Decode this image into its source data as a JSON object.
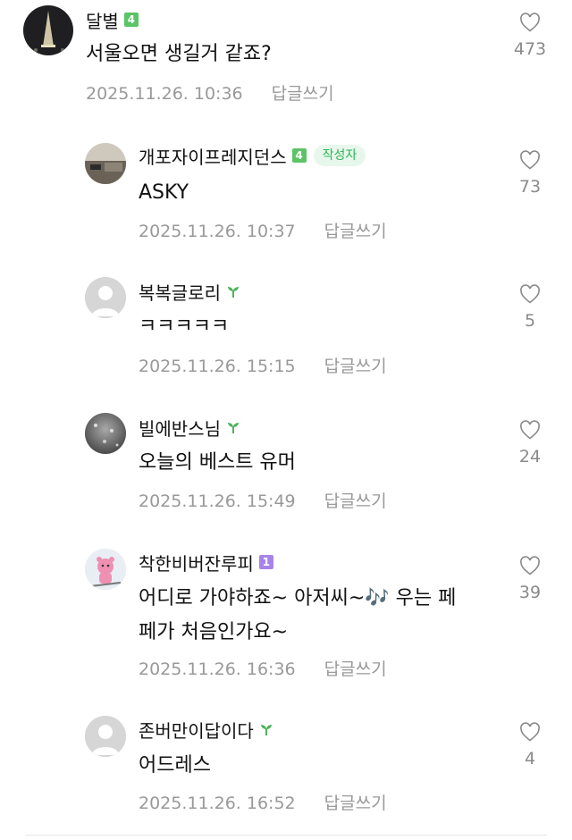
{
  "comments": [
    {
      "author": "달별",
      "badge": "4",
      "text_lines": [
        "서울오면 생길거 같죠?"
      ],
      "date": "2025.11.26. 10:36",
      "reply_label": "답글쓰기",
      "likes": "473"
    },
    {
      "author": "개포자이프레지던스",
      "badge": "4",
      "author_tag": "작성자",
      "text_lines": [
        "ASKY"
      ],
      "date": "2025.11.26. 10:37",
      "reply_label": "답글쓰기",
      "likes": "73"
    },
    {
      "author": "복복글로리",
      "text_lines": [
        "ㅋㅋㅋㅋㅋ"
      ],
      "date": "2025.11.26. 15:15",
      "reply_label": "답글쓰기",
      "likes": "5"
    },
    {
      "author": "빌에반스님",
      "text_lines": [
        "오늘의 베스트 유머"
      ],
      "date": "2025.11.26. 15:49",
      "reply_label": "답글쓰기",
      "likes": "24"
    },
    {
      "author": "착한비버잔루피",
      "badge": "1",
      "text_lines": [
        "어디로 가야하죠~ 아저씨~🎶 우는 페",
        "페가 처음인가요~"
      ],
      "date": "2025.11.26. 16:36",
      "reply_label": "답글쓰기",
      "likes": "39"
    },
    {
      "author": "존버만이답이다",
      "text_lines": [
        "어드레스"
      ],
      "date": "2025.11.26. 16:52",
      "reply_label": "답글쓰기",
      "likes": "4"
    }
  ],
  "colors": {
    "badge_green": "#5ac466",
    "badge_purple": "#a784e8",
    "author_tag_bg": "#e8f7eb",
    "author_tag_text": "#2fb55a",
    "meta_gray": "#999999"
  },
  "icons": {
    "like": "heart-outline-icon",
    "sprout": "sprout-icon"
  }
}
